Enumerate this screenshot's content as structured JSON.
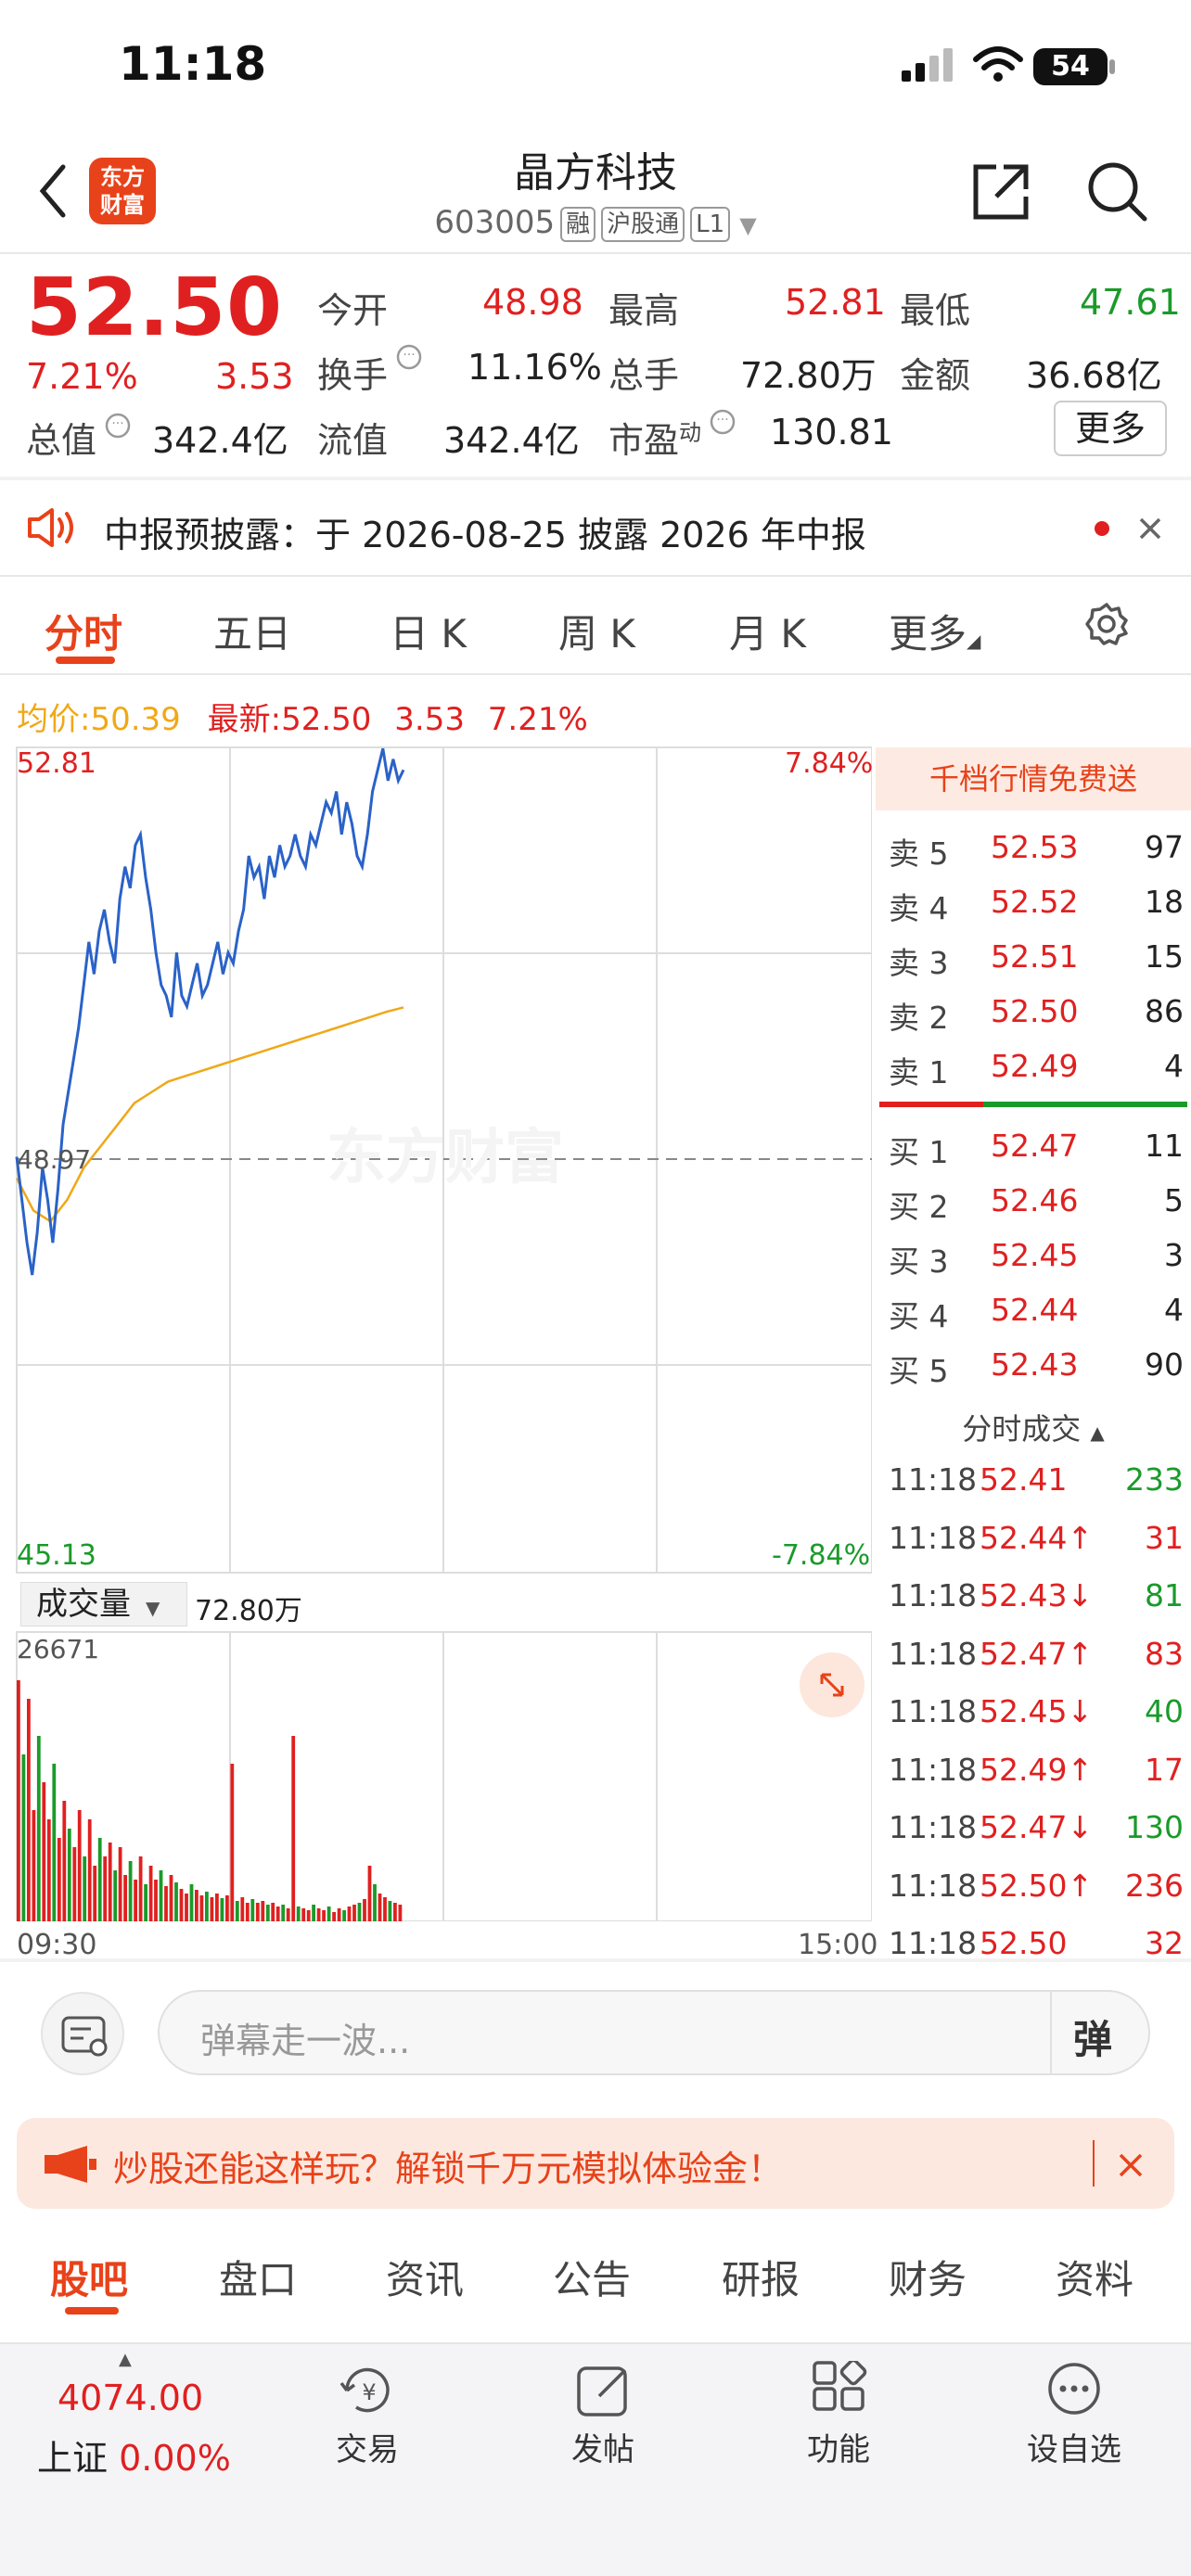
{
  "status_bar": {
    "time": "11:18",
    "battery": "54"
  },
  "header": {
    "title": "晶方科技",
    "code": "603005",
    "tags": [
      "融",
      "沪股通",
      "L1"
    ],
    "logo_line1": "东方",
    "logo_line2": "财富"
  },
  "quote": {
    "price": "52.50",
    "change_pct": "7.21%",
    "change": "3.53",
    "open_label": "今开",
    "open": "48.98",
    "high_label": "最高",
    "high": "52.81",
    "low_label": "最低",
    "low": "47.61",
    "turnover_label": "换手",
    "turnover": "11.16%",
    "volume_label": "总手",
    "volume": "72.80万",
    "amount_label": "金额",
    "amount": "36.68亿",
    "mcap_label": "总值",
    "mcap": "342.4亿",
    "float_label": "流值",
    "float": "342.4亿",
    "pe_label": "市盈",
    "pe_sup": "动",
    "pe": "130.81",
    "more": "更多"
  },
  "notice": {
    "text": "中报预披露：",
    "detail": "于 2026-08-25 披露 2026 年中报"
  },
  "tabs": [
    "分时",
    "五日",
    "日 K",
    "周 K",
    "月 K",
    "更多"
  ],
  "chart": {
    "avg_label": "均价:",
    "avg": "50.39",
    "latest_label": "最新:",
    "latest": "52.50",
    "latest_change": "3.53",
    "latest_pct": "7.21%",
    "top_price": "52.81",
    "top_pct": "7.84%",
    "mid_price": "48.97",
    "bottom_price": "45.13",
    "bottom_pct": "-7.84%",
    "watermark": "东方财富",
    "vol_selector": "成交量",
    "vol_total": "72.80万",
    "vol_max": "26671",
    "time_start": "09:30",
    "time_end": "15:00"
  },
  "orderbook": {
    "banner": "千档行情免费送",
    "asks": [
      {
        "label": "卖 5",
        "price": "52.53",
        "vol": "97"
      },
      {
        "label": "卖 4",
        "price": "52.52",
        "vol": "18"
      },
      {
        "label": "卖 3",
        "price": "52.51",
        "vol": "15"
      },
      {
        "label": "卖 2",
        "price": "52.50",
        "vol": "86"
      },
      {
        "label": "卖 1",
        "price": "52.49",
        "vol": "4"
      }
    ],
    "bids": [
      {
        "label": "买 1",
        "price": "52.47",
        "vol": "11"
      },
      {
        "label": "买 2",
        "price": "52.46",
        "vol": "5"
      },
      {
        "label": "买 3",
        "price": "52.45",
        "vol": "3"
      },
      {
        "label": "买 4",
        "price": "52.44",
        "vol": "4"
      },
      {
        "label": "买 5",
        "price": "52.43",
        "vol": "90"
      }
    ],
    "trades_title": "分时成交",
    "trades": [
      {
        "time": "11:18",
        "price": "52.41",
        "dir": "",
        "vol": "233",
        "vc": "green"
      },
      {
        "time": "11:18",
        "price": "52.44↑",
        "dir": "up",
        "vol": "31",
        "vc": "red"
      },
      {
        "time": "11:18",
        "price": "52.43↓",
        "dir": "down",
        "vol": "81",
        "vc": "green"
      },
      {
        "time": "11:18",
        "price": "52.47↑",
        "dir": "up",
        "vol": "83",
        "vc": "red"
      },
      {
        "time": "11:18",
        "price": "52.45↓",
        "dir": "down",
        "vol": "40",
        "vc": "green"
      },
      {
        "time": "11:18",
        "price": "52.49↑",
        "dir": "up",
        "vol": "17",
        "vc": "red"
      },
      {
        "time": "11:18",
        "price": "52.47↓",
        "dir": "down",
        "vol": "130",
        "vc": "green"
      },
      {
        "time": "11:18",
        "price": "52.50↑",
        "dir": "up",
        "vol": "236",
        "vc": "red"
      },
      {
        "time": "11:18",
        "price": "52.50",
        "dir": "",
        "vol": "32",
        "vc": "red"
      }
    ]
  },
  "danmaku": {
    "placeholder": "弹幕走一波...",
    "button": "弹"
  },
  "promo": {
    "text": "炒股还能这样玩？解锁千万元模拟体验金！"
  },
  "bottom_tabs": [
    "股吧",
    "盘口",
    "资讯",
    "公告",
    "研报",
    "财务",
    "资料"
  ],
  "bottom_nav": {
    "index_value": "4074.00",
    "index_name": "上证",
    "index_pct": "0.00%",
    "items": [
      "交易",
      "发帖",
      "功能",
      "设自选"
    ]
  },
  "colors": {
    "up": "#e02020",
    "down": "#1a9a2a",
    "accent": "#e8421a",
    "price_line": "#2a62c8",
    "avg_line": "#f0a818"
  }
}
